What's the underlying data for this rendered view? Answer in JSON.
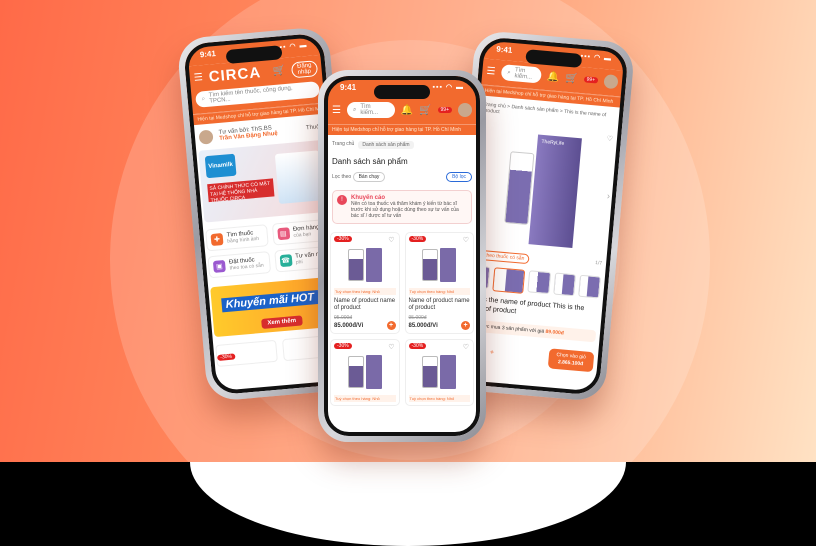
{
  "common": {
    "time": "9:41",
    "signal": "▪▪▪ ◠ ▬"
  },
  "left": {
    "brand": "CIRCA",
    "header_pill": "Đăng nhập",
    "search_placeholder": "Tìm kiếm tên thuốc, công dụng, TPCN...",
    "banner": "Hiện tại Medshop chỉ hỗ trợ giao hàng tại TP. Hồ Chí Minh",
    "consult_label": "Tư vấn bởi: ThS.BS",
    "consult_name": "Trần Văn Đặng Nhuệ",
    "consult_side": "Thuốc",
    "promo_brand": "Vinamilk",
    "promo_text": "SẢ CHÍNH THỨC CÓ MẶT TẠI HỆ THỐNG NHÀ THUỐC CIRCA",
    "tiles": [
      {
        "title": "Tìm thuốc",
        "sub": "bằng hình ảnh",
        "icon": "✚",
        "color": "#f26a2e"
      },
      {
        "title": "Đơn hàng",
        "sub": "của bạn",
        "icon": "▤",
        "color": "#e85a7d"
      },
      {
        "title": "Đặt thuốc",
        "sub": "theo toa có sẵn",
        "icon": "▣",
        "color": "#9b59d0"
      },
      {
        "title": "Tư vấn miễn",
        "sub": "phí",
        "icon": "☎",
        "color": "#27b09a"
      }
    ],
    "km_title": "Khuyến mãi HOT",
    "km_button": "Xem thêm",
    "discount": "-30%"
  },
  "center": {
    "search_placeholder": "Tìm kiếm...",
    "cart_badge": "99+",
    "banner": "Hiện tại Medshop chỉ hỗ trợ giao hàng tại TP. Hồ Chí Minh",
    "crumb_home": "Trang chủ",
    "crumb_current": "Danh sách sản phẩm",
    "heading": "Danh sách sản phẩm",
    "filter_label": "Lọc theo",
    "filter_value": "Bán chạy",
    "filter_button": "Bộ lọc",
    "notice_title": "Khuyến cáo",
    "notice_text": "Nên có toa thuốc và thăm khám ý kiến từ bác sĩ trước khi sử dụng hoặc dùng theo sự tư vấn của bác sĩ / dược sĩ tư vấn",
    "products": [
      {
        "discount": "-30%",
        "note": "Tuỳ chọn theo hàng: Nhỏ",
        "name": "Name of product name of product",
        "old": "95.000đ",
        "price": "85.000đ/Vỉ"
      },
      {
        "discount": "-30%",
        "note": "Tuỳ chọn theo hàng: Nhỏ",
        "name": "Name of product name of product",
        "old": "95.000đ",
        "price": "85.000đ/Vỉ"
      },
      {
        "discount": "-30%",
        "note": "Tuỳ chọn theo hàng: Nhỏ",
        "name": "",
        "old": "",
        "price": ""
      },
      {
        "discount": "-30%",
        "note": "Tuỳ chọn theo hàng: Nhỏ",
        "name": "",
        "old": "",
        "price": ""
      }
    ]
  },
  "right": {
    "search_placeholder": "Tìm kiếm...",
    "cart_badge": "99+",
    "banner": "Hiện tại Medshop chỉ hỗ trợ giao hàng tại TP. Hồ Chí Minh",
    "crumb": "Trang chủ  >  Danh sách sản phẩm  >  This is the name of product",
    "brand_on_box": "TheRyLife",
    "tag": "Giữ theo thuốc có sẵn",
    "image_count": "1/7",
    "title": "This is the name of product This is the name of product",
    "offer_prefix": "Bạn được mua 3 sản phẩm với giá",
    "offer_price": "89.000đ",
    "qty": "1",
    "cart_label": "Chọn vào giỏ",
    "cart_price": "2.865.100đ"
  }
}
